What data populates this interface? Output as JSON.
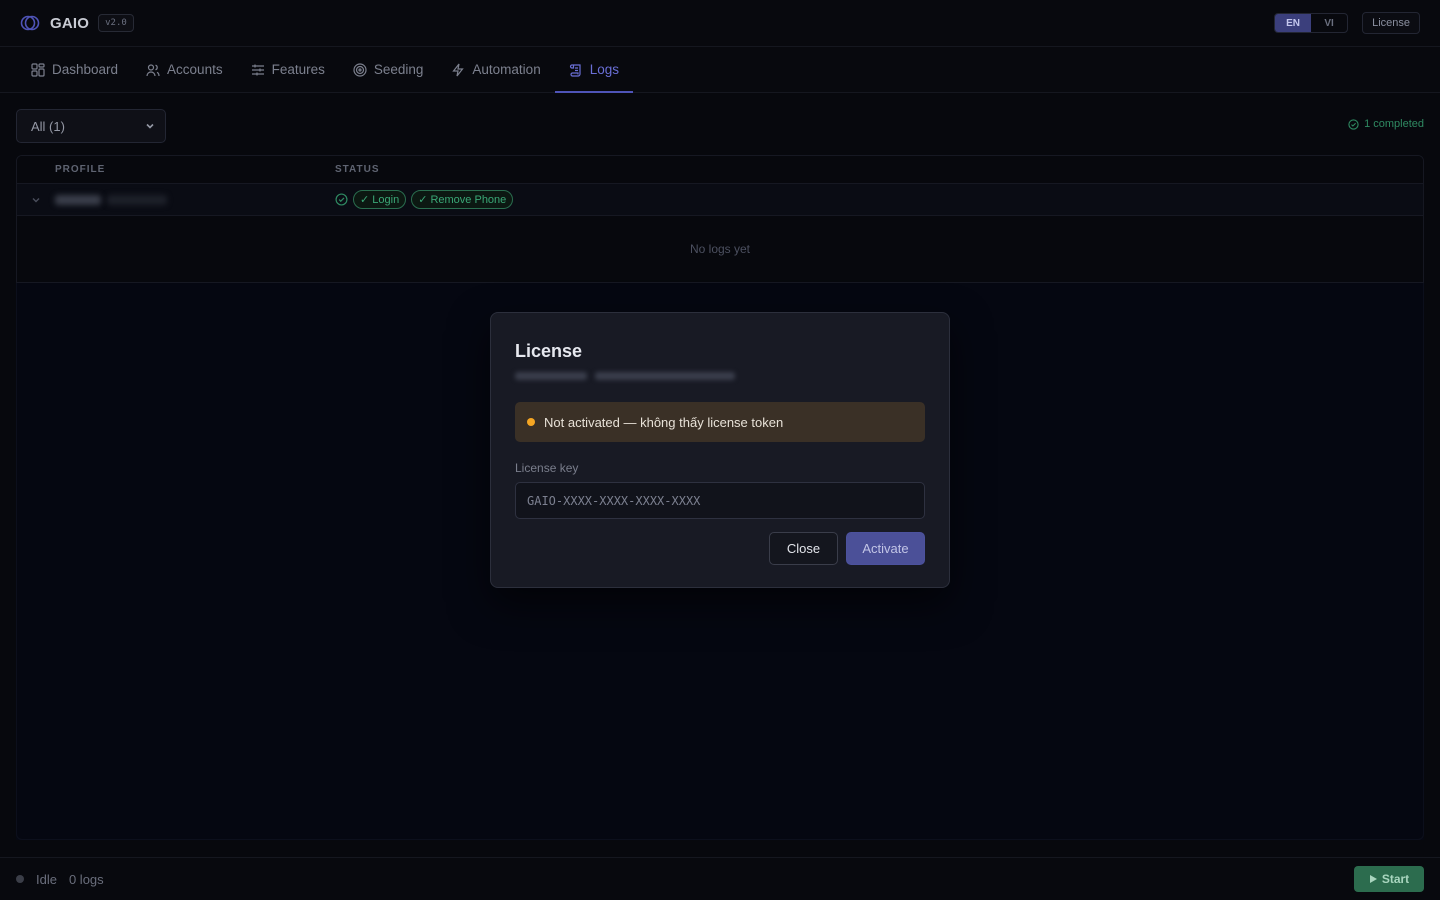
{
  "app": {
    "name": "GAIO",
    "version": "v2.0"
  },
  "header": {
    "languages": [
      {
        "code": "EN",
        "active": true
      },
      {
        "code": "VI",
        "active": false
      }
    ],
    "license_label": "License"
  },
  "nav": {
    "tabs": [
      {
        "label": "Dashboard",
        "icon": "grid-icon",
        "active": false
      },
      {
        "label": "Accounts",
        "icon": "users-icon",
        "active": false
      },
      {
        "label": "Features",
        "icon": "sliders-icon",
        "active": false
      },
      {
        "label": "Seeding",
        "icon": "target-icon",
        "active": false
      },
      {
        "label": "Automation",
        "icon": "bolt-icon",
        "active": false
      },
      {
        "label": "Logs",
        "icon": "scroll-icon",
        "active": true
      }
    ]
  },
  "toolbar": {
    "filter_value": "All (1)",
    "completed_text": "1 completed"
  },
  "table": {
    "columns": [
      "PROFILE",
      "STATUS"
    ],
    "rows": [
      {
        "profile": "",
        "status_badges": [
          "✓ Login",
          "✓ Remove Phone"
        ]
      }
    ],
    "empty_text": "No logs yet"
  },
  "modal": {
    "title": "License",
    "alert_text": "Not activated — không thấy license token",
    "field_label": "License key",
    "key_placeholder": "GAIO-XXXX-XXXX-XXXX-XXXX",
    "close_label": "Close",
    "activate_label": "Activate"
  },
  "footer": {
    "status": "Idle",
    "log_count": "0 logs",
    "start_label": "Start"
  },
  "colors": {
    "accent": "#4f54b8",
    "success": "#2f8a62",
    "warning": "#f5a623",
    "background": "#07080d"
  }
}
